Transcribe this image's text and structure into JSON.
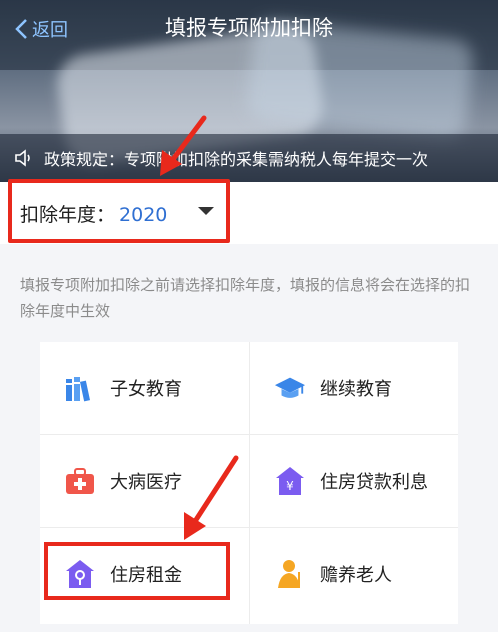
{
  "nav": {
    "back_label": "返回",
    "title": "填报专项附加扣除"
  },
  "notice": {
    "text": "政策规定：专项附加扣除的采集需纳税人每年提交一次"
  },
  "year": {
    "label": "扣除年度：",
    "value": "2020"
  },
  "description": "填报专项附加扣除之前请选择扣除年度，填报的信息将会在选择的扣除年度中生效",
  "items": [
    {
      "label": "子女教育",
      "icon": "books-icon"
    },
    {
      "label": "继续教育",
      "icon": "graduation-cap-icon"
    },
    {
      "label": "大病医疗",
      "icon": "medical-kit-icon"
    },
    {
      "label": "住房贷款利息",
      "icon": "house-yen-icon"
    },
    {
      "label": "住房租金",
      "icon": "house-key-icon"
    },
    {
      "label": "赡养老人",
      "icon": "elderly-person-icon"
    }
  ],
  "colors": {
    "accent": "#2f6fd2",
    "highlight": "#e8291c",
    "icon_blue": "#3a86e8",
    "icon_purple": "#7b5cf0",
    "icon_red": "#f0564a",
    "icon_orange": "#f5a623"
  }
}
